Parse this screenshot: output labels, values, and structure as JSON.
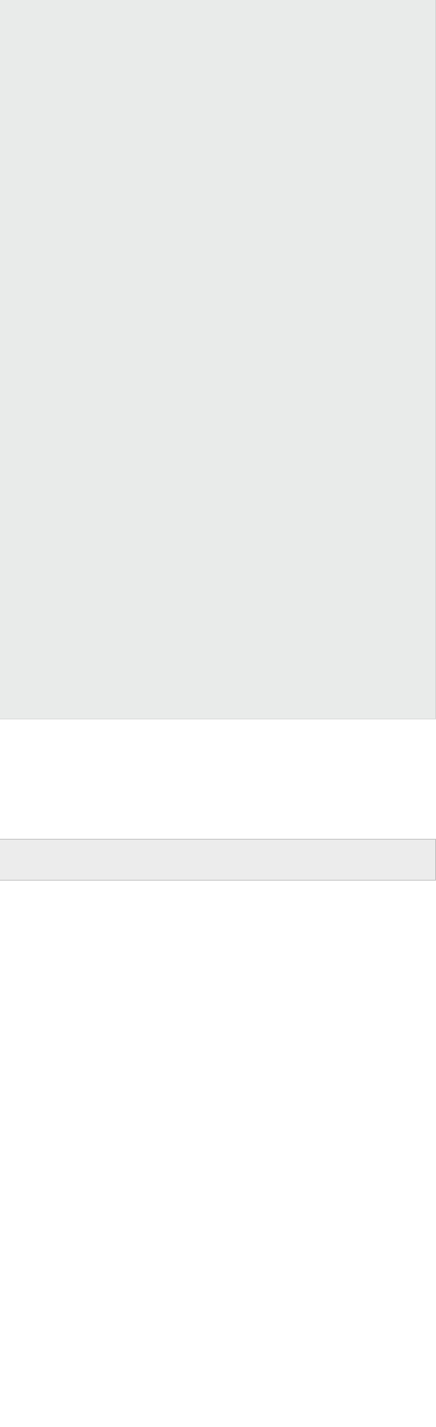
{
  "colors": {
    "page_background": "#ffffff",
    "hero_panel": "#e9ebea",
    "bar_strip": "#ececec",
    "bar_strip_border": "#c8c8c8"
  }
}
